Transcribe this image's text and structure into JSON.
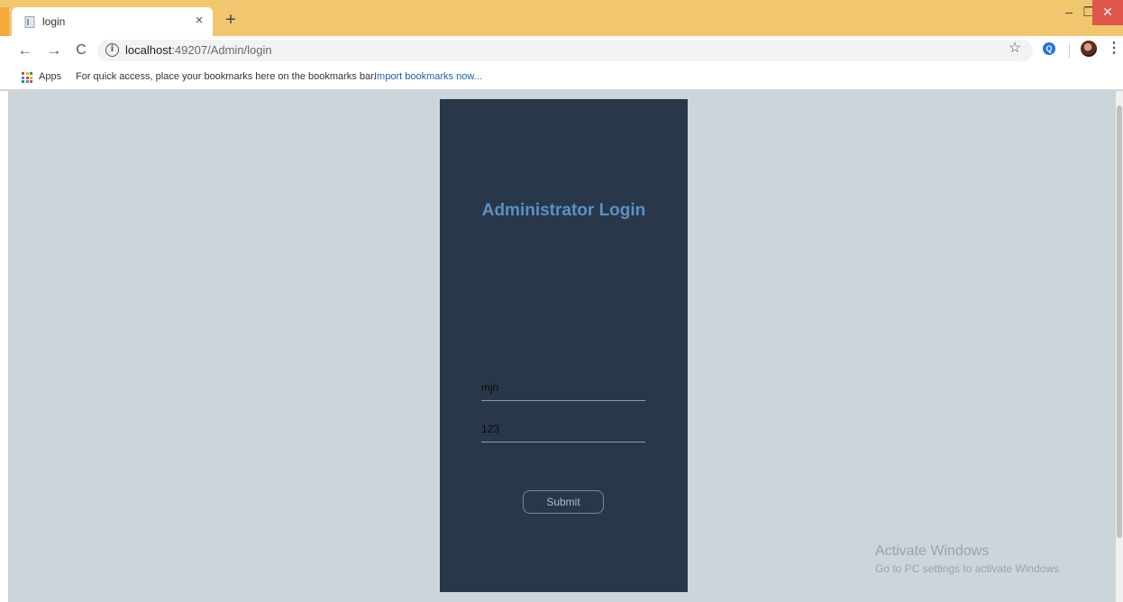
{
  "browser": {
    "tab": {
      "title": "login",
      "close_glyph": "×"
    },
    "new_tab_glyph": "+",
    "window_controls": {
      "minimize": "–",
      "maximize": "❐",
      "close": "✕"
    },
    "nav": {
      "back": "←",
      "forward": "→",
      "reload": "C"
    },
    "address": {
      "host": "localhost",
      "path": ":49207/Admin/login",
      "info_glyph": "i"
    },
    "star_glyph": "☆",
    "extension_glyph": "Q",
    "menu_glyph": "⋮"
  },
  "bookmarks_bar": {
    "apps_label": "Apps",
    "hint": "For quick access, place your bookmarks here on the bookmarks bar.",
    "import_link": "Import bookmarks now..."
  },
  "login": {
    "title": "Administrator Login",
    "username_value": "mjn",
    "password_value": "123",
    "submit_label": "Submit"
  },
  "watermark": {
    "title": "Activate Windows",
    "subtitle": "Go to PC settings to activate Windows."
  },
  "colors": {
    "panel_bg": "#28374a",
    "page_bg": "#ccd5d9",
    "title_color": "#5e8fbf",
    "chrome_frame": "#f0c76e"
  }
}
